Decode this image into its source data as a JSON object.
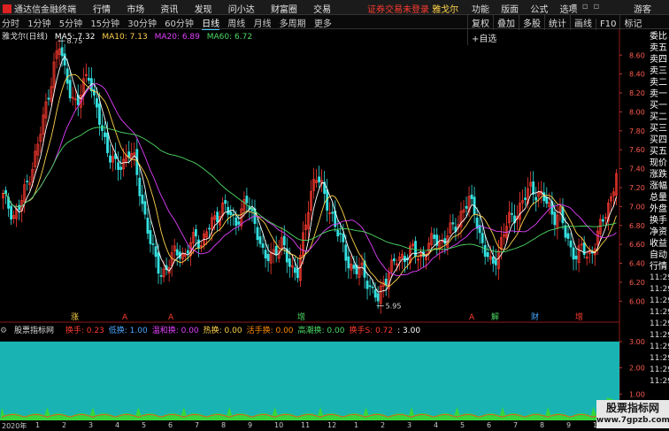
{
  "topbar": {
    "app_title": "通达信金融终端",
    "menus": [
      "行情",
      "市场",
      "资讯",
      "发现",
      "问小达",
      "财富圈",
      "交易"
    ],
    "warning": "证券交易未登录",
    "stock_name": "雅戈尔",
    "right_menus": [
      "功能",
      "版面",
      "公式",
      "选项"
    ],
    "guest": "游客"
  },
  "toolbar": {
    "periods": [
      "分时",
      "1分钟",
      "5分钟",
      "15分钟",
      "30分钟",
      "60分钟",
      "日线",
      "周线",
      "月线",
      "多周期",
      "更多"
    ],
    "active_period": "日线",
    "actions": [
      "复权",
      "叠加",
      "多股",
      "统计",
      "画线",
      "F10",
      "标记",
      "+自选"
    ]
  },
  "ma_legend": {
    "title": "雅戈尔(日线)",
    "items": [
      {
        "label": "MA5: 7.32",
        "color": "#ffffff"
      },
      {
        "label": "MA10: 7.13",
        "color": "#ffd24a"
      },
      {
        "label": "MA20: 6.89",
        "color": "#e040fb"
      },
      {
        "label": "MA60: 6.72",
        "color": "#4cd964"
      }
    ]
  },
  "chart_data": {
    "type": "candlestick",
    "y_ticks": [
      "8.60",
      "8.40",
      "8.20",
      "8.00",
      "7.80",
      "7.60",
      "7.40",
      "7.20",
      "7.00",
      "6.80",
      "6.60",
      "6.40",
      "6.20",
      "6.00"
    ],
    "ylim": [
      5.9,
      8.78
    ],
    "annotations": {
      "high": "8.75",
      "low": "5.95"
    },
    "signals": [
      {
        "text": "涨",
        "color": "#ffd24a"
      },
      {
        "text": "A",
        "color": "#ff3b30"
      },
      {
        "text": "A",
        "color": "#ff3b30"
      },
      {
        "text": "增",
        "color": "#4cd964"
      },
      {
        "text": "A",
        "color": "#ff3b30"
      },
      {
        "text": "解",
        "color": "#4cd964"
      },
      {
        "text": "财",
        "color": "#4aa8ff"
      },
      {
        "text": "增",
        "color": "#ff3b30"
      }
    ],
    "price_path": [
      7.1,
      7.0,
      6.9,
      7.0,
      7.2,
      7.4,
      7.6,
      7.9,
      8.2,
      8.5,
      8.7,
      8.4,
      8.2,
      8.0,
      8.3,
      8.45,
      8.1,
      7.9,
      7.7,
      7.5,
      7.4,
      7.45,
      7.6,
      7.5,
      7.2,
      6.9,
      6.6,
      6.4,
      6.3,
      6.35,
      6.5,
      6.55,
      6.45,
      6.6,
      6.7,
      6.6,
      6.75,
      6.85,
      6.95,
      7.0,
      6.9,
      6.85,
      6.95,
      7.05,
      6.9,
      6.7,
      6.4,
      6.5,
      6.55,
      6.6,
      6.45,
      6.35,
      6.3,
      6.7,
      7.1,
      7.35,
      7.2,
      7.05,
      6.9,
      6.7,
      6.55,
      6.4,
      6.3,
      6.35,
      6.25,
      6.1,
      6.0,
      6.2,
      6.35,
      6.4,
      6.45,
      6.5,
      6.55,
      6.45,
      6.5,
      6.6,
      6.65,
      6.6,
      6.7,
      6.75,
      6.8,
      7.0,
      7.05,
      6.95,
      6.7,
      6.5,
      6.35,
      6.5,
      6.7,
      6.85,
      6.9,
      7.0,
      7.1,
      7.2,
      7.15,
      7.1,
      7.0,
      6.9,
      6.95,
      6.7,
      6.55,
      6.5,
      6.55,
      6.45,
      6.6,
      6.75,
      6.9,
      7.1,
      7.35
    ]
  },
  "indicator": {
    "name": "股票指标网",
    "items": [
      {
        "label": "换手:",
        "value": "0.23",
        "color": "#ff3b30"
      },
      {
        "label": "低换:",
        "value": "1.00",
        "color": "#4aa8ff"
      },
      {
        "label": "温和换:",
        "value": "0.00",
        "color": "#e040fb"
      },
      {
        "label": "热换:",
        "value": "0.00",
        "color": "#ffd24a"
      },
      {
        "label": "活手换:",
        "value": "0.00",
        "color": "#ff8a00"
      },
      {
        "label": "高潮换:",
        "value": "0.00",
        "color": "#4cd964"
      },
      {
        "label": "换手S:",
        "value": "0.72",
        "color": "#ff3b30"
      },
      {
        "label": ":",
        "value": "3.00",
        "color": "#ffffff"
      }
    ],
    "y_ticks": [
      "3.00",
      "2.00",
      "1.00"
    ],
    "ylim": [
      0,
      3.2
    ]
  },
  "x_axis": {
    "year": "2020年",
    "months": [
      "1",
      "2",
      "3",
      "4",
      "5",
      "6",
      "7",
      "8",
      "9",
      "10",
      "11",
      "12",
      "1",
      "2",
      "3",
      "4",
      "5",
      "6",
      "7",
      "8",
      "9",
      "10"
    ]
  },
  "sidebar": {
    "labels": [
      "委比",
      "卖五",
      "卖四",
      "卖三",
      "卖二",
      "卖一",
      "买一",
      "买二",
      "买三",
      "买四",
      "买五",
      "现价",
      "涨跌",
      "涨幅",
      "总量",
      "外盘",
      "换手",
      "净资",
      "收益",
      "自动",
      "行情"
    ],
    "times": [
      "11:29",
      "11:29",
      "11:29",
      "11:29",
      "11:29",
      "11:29",
      "11:29",
      "11:29",
      "11:29",
      "11:29"
    ]
  },
  "watermark": {
    "title": "股票指标网",
    "url": "www.7gpzb.com"
  },
  "colors": {
    "up": "#ff3b30",
    "down": "#35e0e0",
    "teal_fill": "#19b3b3",
    "green_fill": "#37d63a"
  }
}
